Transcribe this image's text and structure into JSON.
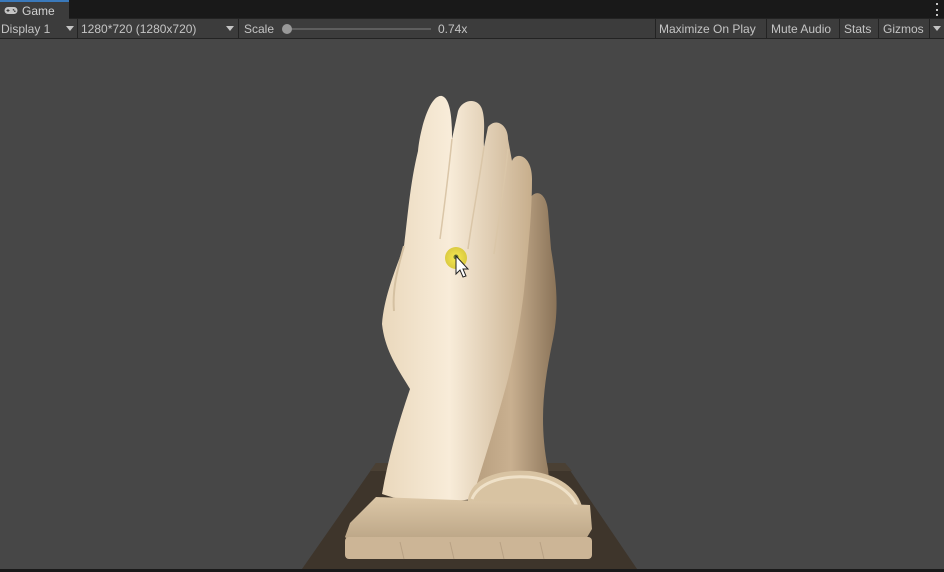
{
  "tab": {
    "title": "Game",
    "icon": "gamepad-icon"
  },
  "toolbar": {
    "display": "Display 1",
    "resolution": "1280*720 (1280x720)",
    "scale_label": "Scale",
    "scale_value": "0.74x",
    "maximize": "Maximize On Play",
    "mute": "Mute Audio",
    "stats": "Stats",
    "gizmos": "Gizmos"
  },
  "colors": {
    "viewport_bg": "#474747",
    "toolbar_bg": "#3c3c3c",
    "tab_accent": "#3a79bb",
    "cursor_highlight": "#f2e25a"
  }
}
